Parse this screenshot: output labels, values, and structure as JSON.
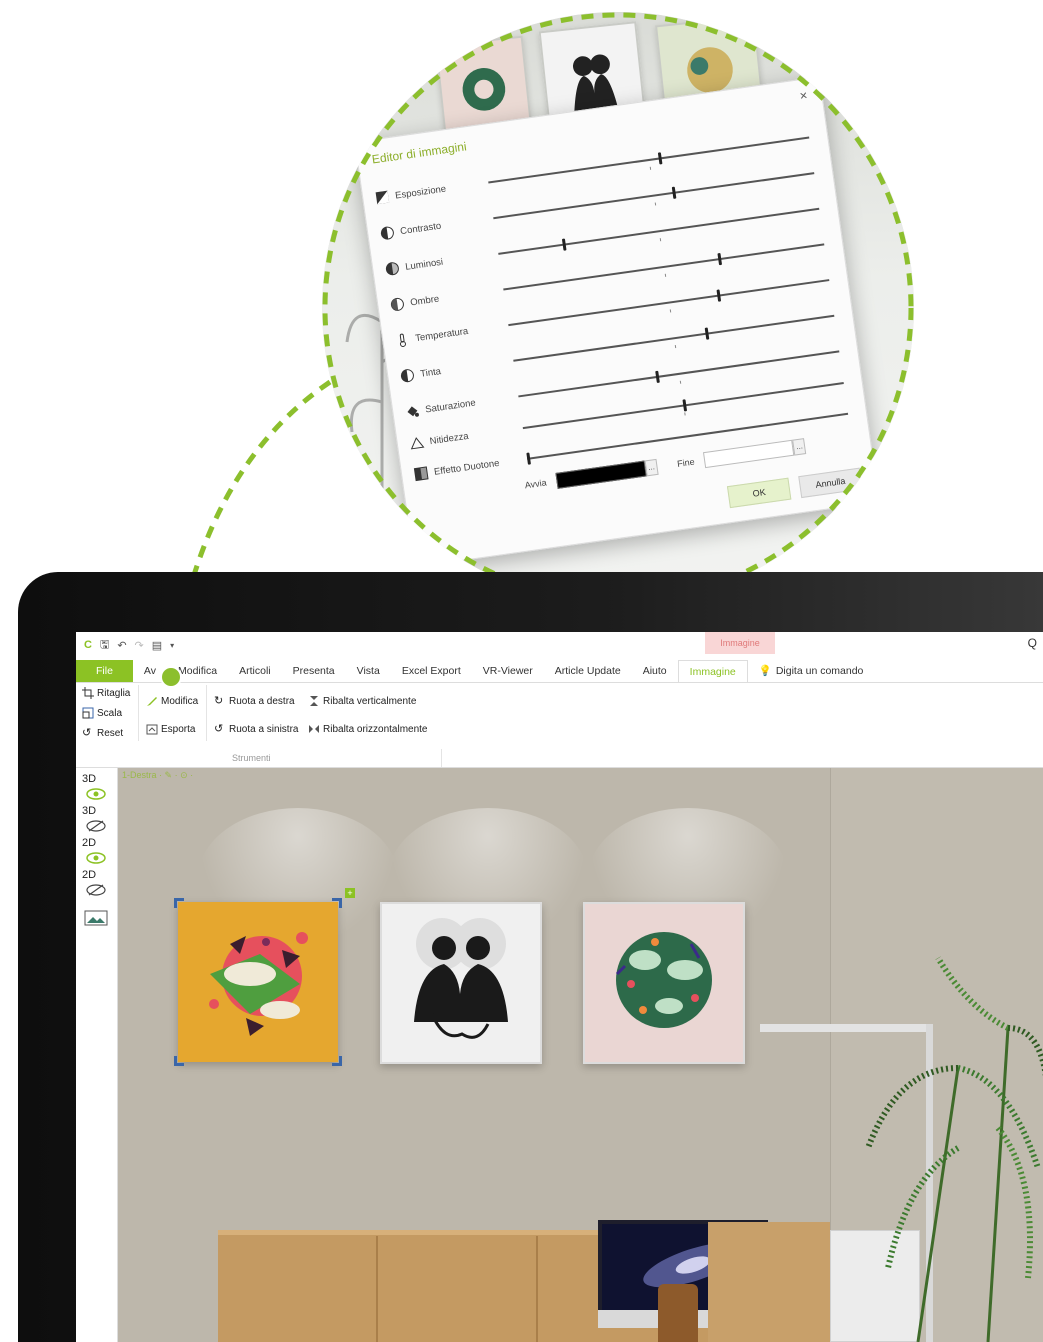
{
  "dialog": {
    "title": "Editor di immagini",
    "close": "×",
    "sliders": [
      {
        "label": "Esposizione",
        "icon": "exposure-icon",
        "value": 0.53
      },
      {
        "label": "Contrasto",
        "icon": "contrast-icon",
        "value": 0.56
      },
      {
        "label": "Luminosi",
        "icon": "highlights-icon",
        "value": 0.2
      },
      {
        "label": "Ombre",
        "icon": "shadows-icon",
        "value": 0.67
      },
      {
        "label": "Temperatura",
        "icon": "thermometer-icon",
        "value": 0.65
      },
      {
        "label": "Tinta",
        "icon": "tint-icon",
        "value": 0.6
      },
      {
        "label": "Saturazione",
        "icon": "saturation-icon",
        "value": 0.43
      },
      {
        "label": "Nitidezza",
        "icon": "sharpness-icon",
        "value": 0.5
      }
    ],
    "duotone": {
      "label": "Effetto Duotone",
      "value": 0.0,
      "start_label": "Avvia",
      "end_label": "Fine",
      "start_color": "#000000",
      "end_color": "#ffffff",
      "more": "..."
    },
    "ok": "OK",
    "cancel": "Annulla"
  },
  "app": {
    "context_tab_header": "Immagine",
    "qat_right": "Q",
    "tabs": [
      "File",
      "Av",
      "Modifica",
      "Articoli",
      "Presenta",
      "Vista",
      "Excel Export",
      "VR-Viewer",
      "Article Update",
      "Aiuto",
      "Immagine"
    ],
    "active_tab": "Immagine",
    "command_search": "Digita un comando",
    "ribbon": {
      "crop": "Ritaglia",
      "scale": "Scala",
      "reset": "Reset",
      "edit": "Modifica",
      "export": "Esporta",
      "rotate_right": "Ruota a destra",
      "rotate_left": "Ruota a sinistra",
      "flip_vertical": "Ribalta verticalmente",
      "flip_horizontal": "Ribalta orizzontalmente",
      "group_label": "Strumenti"
    },
    "viewport_breadcrumb": "1-Destra",
    "left_toolbar": [
      "3D",
      "3D",
      "2D",
      "2D"
    ]
  },
  "colors": {
    "accent": "#8cc224",
    "selection": "#3a66a8",
    "wall": "#bdb7ab"
  }
}
